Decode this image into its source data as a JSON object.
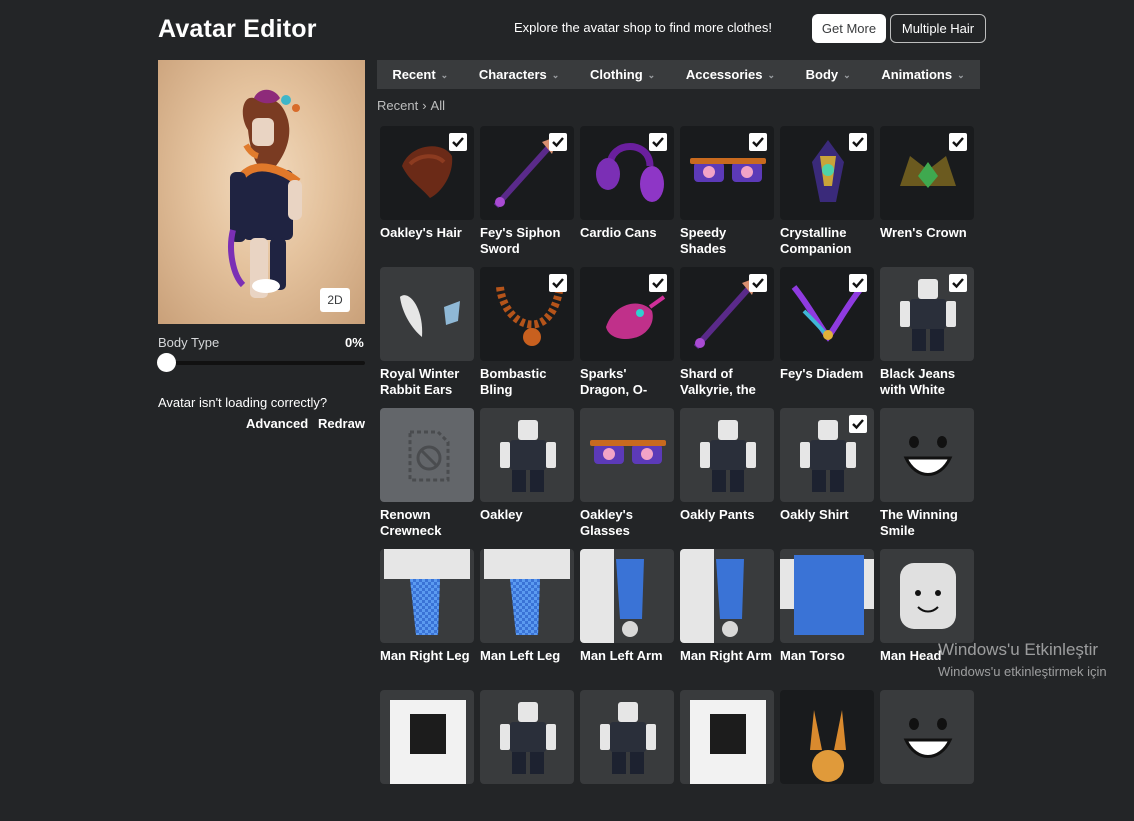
{
  "header": {
    "title": "Avatar Editor",
    "explore_text": "Explore the avatar shop to find more clothes!",
    "get_more_label": "Get More",
    "multiple_hair_label": "Multiple Hair"
  },
  "preview": {
    "toggle_label": "2D",
    "body_type_label": "Body Type",
    "body_type_value": "0%",
    "body_type_level": 0,
    "loading_text": "Avatar isn't loading correctly?",
    "advanced_label": "Advanced",
    "redraw_label": "Redraw"
  },
  "nav": {
    "tabs": [
      {
        "label": "Recent"
      },
      {
        "label": "Characters"
      },
      {
        "label": "Clothing"
      },
      {
        "label": "Accessories"
      },
      {
        "label": "Body"
      },
      {
        "label": "Animations"
      }
    ]
  },
  "breadcrumb": {
    "parent": "Recent",
    "separator": "›",
    "current": "All"
  },
  "items": [
    {
      "name": "Oakley's Hair",
      "checked": true,
      "icon": "hair-icon"
    },
    {
      "name": "Fey's Siphon Sword",
      "checked": true,
      "icon": "sword-icon"
    },
    {
      "name": "Cardio Cans",
      "checked": true,
      "icon": "headphones-icon"
    },
    {
      "name": "Speedy Shades",
      "checked": true,
      "icon": "glasses-icon"
    },
    {
      "name": "Crystalline Companion",
      "checked": true,
      "icon": "companion-icon"
    },
    {
      "name": "Wren's Crown",
      "checked": true,
      "icon": "crown-icon"
    },
    {
      "name": "Royal Winter Rabbit Ears",
      "checked": false,
      "icon": "ears-icon"
    },
    {
      "name": "Bombastic Bling",
      "checked": true,
      "icon": "necklace-icon"
    },
    {
      "name": "Sparks' Dragon, O-",
      "checked": true,
      "icon": "dragon-icon"
    },
    {
      "name": "Shard of Valkyrie, the",
      "checked": true,
      "icon": "sword-icon"
    },
    {
      "name": "Fey's Diadem",
      "checked": true,
      "icon": "diadem-icon"
    },
    {
      "name": "Black Jeans with White",
      "checked": true,
      "icon": "avatar-icon"
    },
    {
      "name": "Renown Crewneck",
      "checked": false,
      "icon": "unavailable-icon"
    },
    {
      "name": "Oakley",
      "checked": false,
      "icon": "avatar-icon"
    },
    {
      "name": "Oakley's Glasses",
      "checked": false,
      "icon": "glasses-icon"
    },
    {
      "name": "Oakly Pants",
      "checked": false,
      "icon": "avatar-icon"
    },
    {
      "name": "Oakly Shirt",
      "checked": true,
      "icon": "avatar-icon"
    },
    {
      "name": "The Winning Smile",
      "checked": false,
      "icon": "face-icon"
    },
    {
      "name": "Man Right Leg",
      "checked": false,
      "icon": "leg-icon"
    },
    {
      "name": "Man Left Leg",
      "checked": false,
      "icon": "leg-icon"
    },
    {
      "name": "Man Left Arm",
      "checked": false,
      "icon": "arm-icon"
    },
    {
      "name": "Man Right Arm",
      "checked": false,
      "icon": "arm-icon"
    },
    {
      "name": "Man Torso",
      "checked": false,
      "icon": "torso-icon"
    },
    {
      "name": "Man Head",
      "checked": false,
      "icon": "head-icon"
    },
    {
      "name": "",
      "checked": false,
      "icon": "shirt-icon"
    },
    {
      "name": "",
      "checked": false,
      "icon": "avatar-icon"
    },
    {
      "name": "",
      "checked": false,
      "icon": "avatar-icon"
    },
    {
      "name": "",
      "checked": false,
      "icon": "shirt-icon"
    },
    {
      "name": "",
      "checked": false,
      "icon": "bunny-icon"
    },
    {
      "name": "",
      "checked": false,
      "icon": "face-icon"
    }
  ],
  "watermark": {
    "line1": "Windows'u Etkinleştir",
    "line2": "Windows'u etkinleştirmek için"
  },
  "colors": {
    "background": "#232527",
    "nav_bar": "#393b3d",
    "tile_dark": "#191b1d",
    "tile_light": "#393b3d",
    "accent_purple": "#7b2fb5",
    "check_blue": "#3a73d6"
  }
}
